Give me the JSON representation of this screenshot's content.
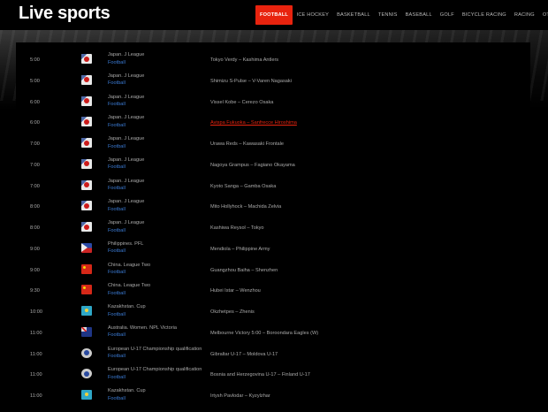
{
  "site": {
    "logo": "Live sports"
  },
  "nav": [
    {
      "label": "FOOTBALL",
      "active": true
    },
    {
      "label": "ICE HOCKEY",
      "active": false
    },
    {
      "label": "BASKETBALL",
      "active": false
    },
    {
      "label": "TENNIS",
      "active": false
    },
    {
      "label": "BASEBALL",
      "active": false
    },
    {
      "label": "GOLF",
      "active": false
    },
    {
      "label": "BICYCLE RACING",
      "active": false
    },
    {
      "label": "RACING",
      "active": false
    },
    {
      "label": "OTHER",
      "active": false
    }
  ],
  "matches": [
    {
      "time": "5:00",
      "flag": "jp",
      "league": "Japan. J League",
      "sport": "Football",
      "match": "Tokyo Verdy – Kashima Antlers",
      "highlight": false
    },
    {
      "time": "5:00",
      "flag": "jp",
      "league": "Japan. J League",
      "sport": "Football",
      "match": "Shimizu S-Pulse – V-Varen Nagasaki",
      "highlight": false
    },
    {
      "time": "6:00",
      "flag": "jp",
      "league": "Japan. J League",
      "sport": "Football",
      "match": "Vissel Kobe – Cerezo Osaka",
      "highlight": false
    },
    {
      "time": "6:00",
      "flag": "jp",
      "league": "Japan. J League",
      "sport": "Football",
      "match": "Avispa Fukuoka – Sanfrecce Hiroshima",
      "highlight": true
    },
    {
      "time": "7:00",
      "flag": "jp",
      "league": "Japan. J League",
      "sport": "Football",
      "match": "Urawa Reds – Kawasaki Frontale",
      "highlight": false
    },
    {
      "time": "7:00",
      "flag": "jp",
      "league": "Japan. J League",
      "sport": "Football",
      "match": "Nagoya Grampus – Fagiano Okayama",
      "highlight": false
    },
    {
      "time": "7:00",
      "flag": "jp",
      "league": "Japan. J League",
      "sport": "Football",
      "match": "Kyoto Sanga – Gamba Osaka",
      "highlight": false
    },
    {
      "time": "8:00",
      "flag": "jp",
      "league": "Japan. J League",
      "sport": "Football",
      "match": "Mito Hollyhock – Machida Zelvia",
      "highlight": false
    },
    {
      "time": "8:00",
      "flag": "jp",
      "league": "Japan. J League",
      "sport": "Football",
      "match": "Kashiwa Reysol – Tokyo",
      "highlight": false
    },
    {
      "time": "9:00",
      "flag": "ph",
      "league": "Philippines. PFL",
      "sport": "Football",
      "match": "Mendiola – Philippine Army",
      "highlight": false
    },
    {
      "time": "9:00",
      "flag": "cn",
      "league": "China. League Two",
      "sport": "Football",
      "match": "Guangzhou Baiha – Shenzhen",
      "highlight": false
    },
    {
      "time": "9:30",
      "flag": "cn",
      "league": "China. League Two",
      "sport": "Football",
      "match": "Hubei Istar – Wenzhou",
      "highlight": false
    },
    {
      "time": "10:00",
      "flag": "kz",
      "league": "Kazakhstan. Cup",
      "sport": "Football",
      "match": "Okzhetpes – Zhenis",
      "highlight": false
    },
    {
      "time": "11:00",
      "flag": "au",
      "league": "Australia. Women. NPL Victoria",
      "sport": "Football",
      "match": "Melbourne Victory 5:00 – Boroondara Eagles (W)",
      "highlight": false
    },
    {
      "time": "11:00",
      "flag": "eu",
      "league": "European U-17 Championship qualification",
      "sport": "Football",
      "match": "Gibraltar U-17 – Moldova U-17",
      "highlight": false
    },
    {
      "time": "11:00",
      "flag": "eu",
      "league": "European U-17 Championship qualification",
      "sport": "Football",
      "match": "Bosnia and Herzegovina U-17 – Finland U-17",
      "highlight": false
    },
    {
      "time": "11:00",
      "flag": "kz",
      "league": "Kazakhstan. Cup",
      "sport": "Football",
      "match": "Irtysh Pavlodar – Kyzylzhar",
      "highlight": false
    }
  ]
}
